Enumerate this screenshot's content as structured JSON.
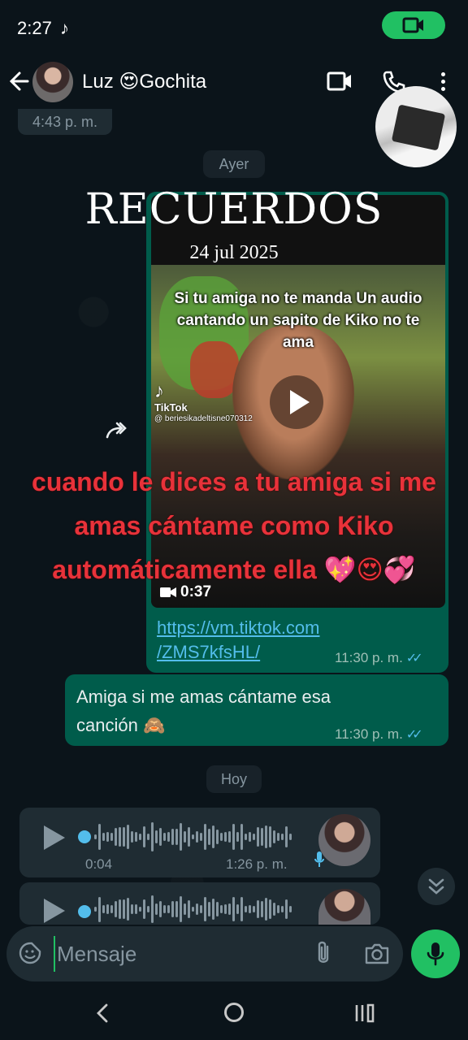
{
  "status_bar": {
    "time": "2:27",
    "tiktok_icon": "♪"
  },
  "header": {
    "contact_name": "Luz 😍Gochita"
  },
  "messages": {
    "prev_time": "4:43 p. m.",
    "day_ayer": "Ayer",
    "video": {
      "overlay_text": "Si tu amiga no te manda Un audio cantando un sapito de Kiko no te ama",
      "tiktok_label": "TikTok",
      "tiktok_handle": "@ beriesikadeltisne070312",
      "duration": "0:37",
      "link_line1": "https://vm.tiktok.com",
      "link_line2": "/ZMS7kfsHL/",
      "time": "11:30 p. m."
    },
    "text_message": {
      "body": "Amiga si me amas cántame esa canción 🙈",
      "time": "11:30 p. m."
    },
    "day_hoy": "Hoy",
    "voice_note_1": {
      "duration": "0:04",
      "time": "1:26 p. m."
    }
  },
  "meme_overlay": {
    "title": "RECUERDOS",
    "date": "24 jul 2025",
    "caption": "cuando le dices a tu amiga si me amas cántame como Kiko automáticamente ella 💖😍💞"
  },
  "composer": {
    "placeholder": "Mensaje"
  },
  "colors": {
    "outgoing_bubble": "#005c4b",
    "incoming_bubble": "#1f2c33",
    "accent_green": "#21c063",
    "link_blue": "#53bdeb",
    "caption_red": "#e8323a"
  },
  "icons": [
    "video-call-icon",
    "voice-call-icon",
    "menu-icon",
    "back-arrow-icon",
    "play-icon",
    "forward-icon",
    "mic-icon",
    "attach-icon",
    "camera-icon",
    "sticker-icon",
    "chevron-double-down-icon"
  ]
}
